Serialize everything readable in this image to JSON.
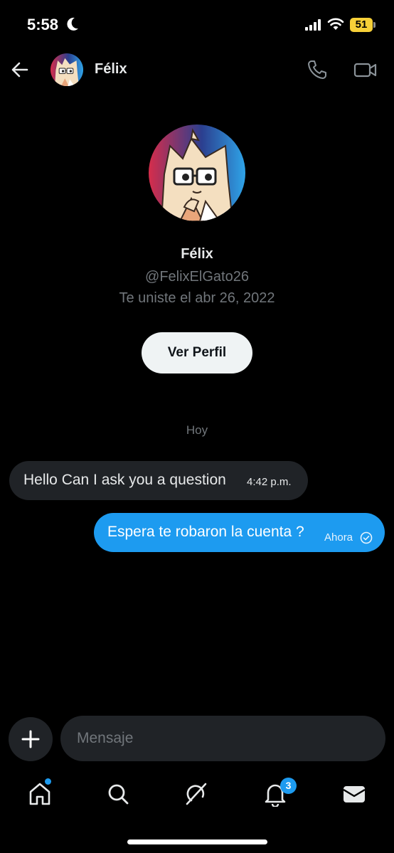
{
  "status_bar": {
    "time": "5:58",
    "battery_level": "51",
    "icons": [
      "moon-icon",
      "signal-icon",
      "wifi-icon",
      "battery-icon"
    ]
  },
  "header": {
    "name": "Félix",
    "icons": [
      "back-arrow-icon",
      "phone-icon",
      "video-icon"
    ]
  },
  "profile": {
    "name": "Félix",
    "handle": "@FelixElGato26",
    "joined": "Te uniste el abr 26, 2022",
    "view_profile_label": "Ver Perfil"
  },
  "chat": {
    "date_divider": "Hoy",
    "messages": [
      {
        "direction": "incoming",
        "text": "Hello Can I ask you a question",
        "time": "4:42 p.m."
      },
      {
        "direction": "outgoing",
        "text": "Espera te robaron la cuenta ?",
        "time": "Ahora",
        "status": "read-check-icon"
      }
    ]
  },
  "composer": {
    "placeholder": "Mensaje",
    "add_icon": "plus-icon"
  },
  "bottom_nav": {
    "items": [
      "home-icon",
      "search-icon",
      "grok-icon",
      "bell-icon",
      "mail-icon"
    ],
    "notification_count": "3"
  },
  "colors": {
    "accent": "#1d9bf0",
    "background": "#000000",
    "bubble_incoming": "#202327",
    "secondary_text": "#71767b"
  }
}
